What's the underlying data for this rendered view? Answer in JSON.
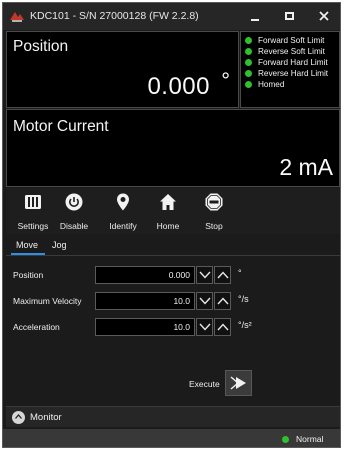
{
  "window": {
    "title": "KDC101 - S/N 27000128 (FW 2.2.8)"
  },
  "position": {
    "label": "Position",
    "value": "0.000",
    "unit": "°"
  },
  "limits": [
    {
      "label": "Forward Soft Limit",
      "color": "#2fbf2f"
    },
    {
      "label": "Reverse Soft Limit",
      "color": "#2fbf2f"
    },
    {
      "label": "Forward Hard Limit",
      "color": "#2fbf2f"
    },
    {
      "label": "Reverse Hard Limit",
      "color": "#2fbf2f"
    },
    {
      "label": "Homed",
      "color": "#2fbf2f"
    }
  ],
  "motor_current": {
    "label": "Motor Current",
    "value": "2 mA"
  },
  "toolbar": {
    "items": [
      {
        "label": "Settings",
        "icon": "settings-icon"
      },
      {
        "label": "Disable",
        "icon": "power-icon"
      },
      {
        "label": "Identify",
        "icon": "map-pin-icon"
      },
      {
        "label": "Home",
        "icon": "home-icon"
      },
      {
        "label": "Stop",
        "icon": "stop-sign-icon"
      }
    ]
  },
  "tabs": [
    {
      "label": "Move",
      "active": true
    },
    {
      "label": "Jog",
      "active": false
    }
  ],
  "move": {
    "fields": [
      {
        "label": "Position",
        "value": "0.000",
        "unit": "°"
      },
      {
        "label": "Maximum Velocity",
        "value": "10.0",
        "unit": "°/s"
      },
      {
        "label": "Acceleration",
        "value": "10.0",
        "unit": "°/s²"
      }
    ],
    "execute_label": "Execute"
  },
  "monitor": {
    "label": "Monitor"
  },
  "status": {
    "text": "Normal",
    "color": "#2fbf2f"
  },
  "colors": {
    "accent": "#2f8ee6",
    "background": "#1b1b1b",
    "panel": "#000000"
  }
}
